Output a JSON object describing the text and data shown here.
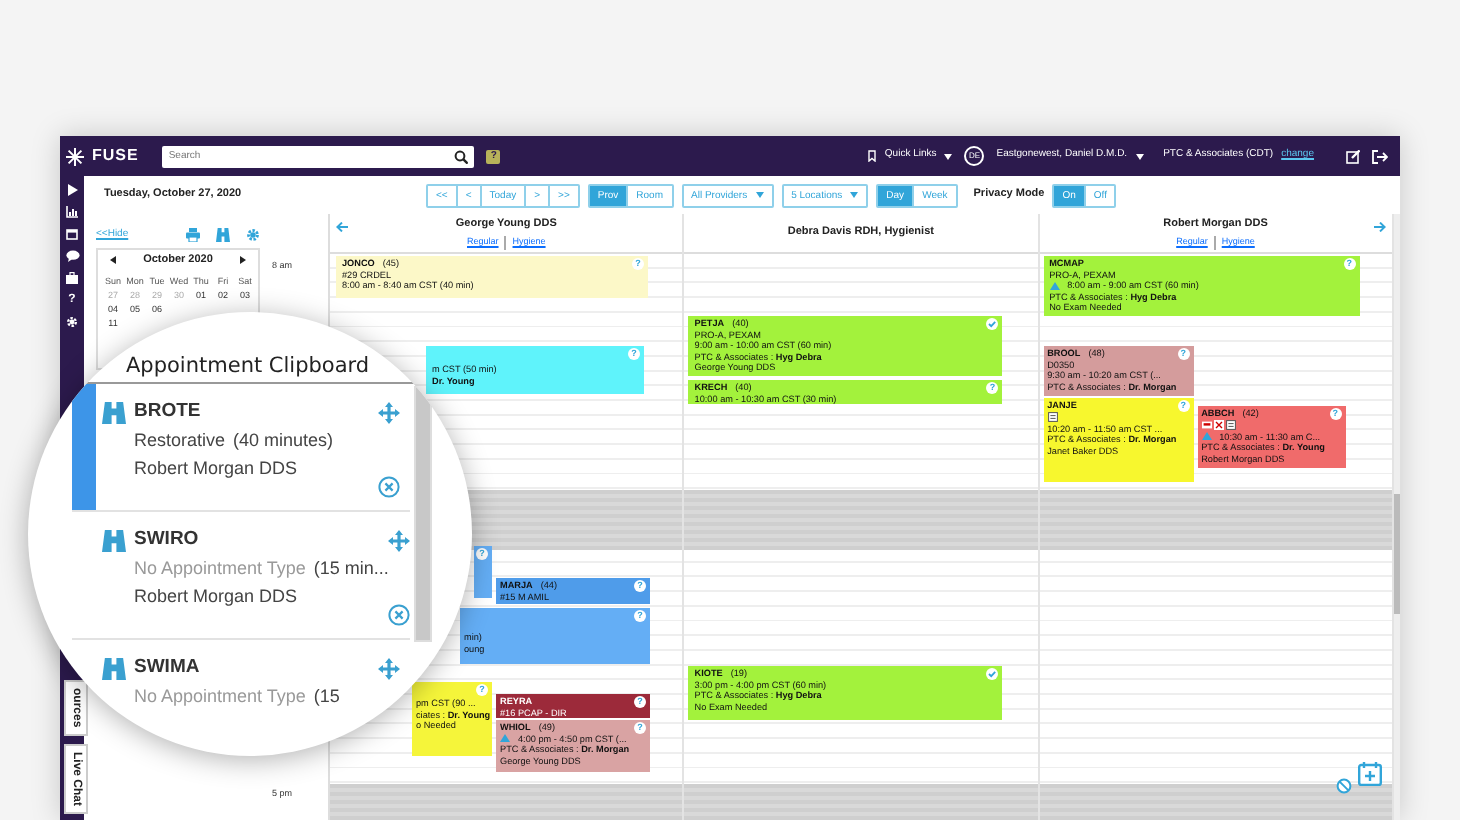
{
  "topbar": {
    "logo": "FUSE",
    "search": {
      "placeholder": "Search"
    },
    "help": "?",
    "quick_links": "Quick Links",
    "avatar_initials": "DE",
    "user_name": "Eastgonewest, Daniel D.M.D.",
    "practice": "PTC & Associates (CDT)",
    "change_link": "change"
  },
  "sidebar": {
    "help": "?",
    "tabs": [
      "ources",
      "Live Chat"
    ]
  },
  "toolbar": {
    "date": "Tuesday, October 27, 2020",
    "nav_buttons": [
      "<<",
      "<",
      "Today",
      ">",
      ">>"
    ],
    "view_toggle": [
      {
        "label": "Prov",
        "selected": true
      },
      {
        "label": "Room",
        "selected": false
      }
    ],
    "dropdowns": [
      "All Providers",
      "5 Locations"
    ],
    "range_toggle": [
      {
        "label": "Day",
        "selected": true
      },
      {
        "label": "Week",
        "selected": false
      }
    ],
    "privacy_label": "Privacy Mode",
    "privacy_toggle": [
      {
        "label": "On",
        "selected": true
      },
      {
        "label": "Off",
        "selected": false
      }
    ]
  },
  "left_panel": {
    "hide_link": "<<Hide",
    "calendar": {
      "month": "October 2020",
      "weekdays": [
        "Sun",
        "Mon",
        "Tue",
        "Wed",
        "Thu",
        "Fri",
        "Sat"
      ],
      "weeks": [
        [
          {
            "day": "27",
            "muted": true
          },
          {
            "day": "28",
            "muted": true
          },
          {
            "day": "29",
            "muted": true
          },
          {
            "day": "30",
            "muted": true
          },
          {
            "day": "01",
            "muted": false
          },
          {
            "day": "02",
            "muted": false
          },
          {
            "day": "03",
            "muted": false
          }
        ],
        [
          {
            "day": "04",
            "muted": false
          },
          {
            "day": "05",
            "muted": false
          },
          {
            "day": "06",
            "muted": false
          }
        ],
        [
          {
            "day": "11",
            "muted": false
          }
        ]
      ]
    }
  },
  "time_labels": [
    "8 am",
    "5 pm"
  ],
  "providers": [
    {
      "name": "George Young DDS",
      "tabs": [
        "Regular",
        "Hygiene"
      ],
      "has_prev": true,
      "has_next": false,
      "appointments": [
        {
          "name": "JONCO",
          "count": "(45)",
          "procedure": "#29 CRDEL",
          "time": "8:00 am - 8:40 am CST (40 min)",
          "time_alert": false,
          "color": "#fcf8c8",
          "help_mark": "?",
          "confirmed": false
        },
        {
          "lines": [
            "m CST (50 min)",
            "**Dr. Young**"
          ],
          "color": "#5ff3fb",
          "help_mark": "?",
          "confirmed": false
        },
        {
          "color": "#64aef5",
          "help_mark": "?",
          "confirmed": false
        },
        {
          "name": "MARJA",
          "count": "(44)",
          "procedure": "#15 M AMIL",
          "color": "#4f9cea",
          "help_mark": "?",
          "confirmed": false
        },
        {
          "lines": [
            "min)",
            "oung"
          ],
          "color": "#64aef5",
          "help_mark": "?",
          "confirmed": false
        },
        {
          "lines": [
            "pm CST (90 ...",
            "ciates : **Dr. Young**",
            "o Needed"
          ],
          "color": "#f5f53a",
          "help_mark": "?",
          "confirmed": false
        },
        {
          "name": "REYRA",
          "procedure": "#16 PCAP - DIR",
          "color": "#9c2a3a",
          "help_mark": "?",
          "confirmed": false
        },
        {
          "name": "WHIOL",
          "count": "(49)",
          "time": "4:00 pm - 4:50 pm CST (...",
          "time_alert": true,
          "lines": [
            "PTC & Associates : **Dr. Morgan**",
            "George Young DDS"
          ],
          "color": "#d9a3a3",
          "help_mark": "?",
          "confirmed": false
        }
      ]
    },
    {
      "name": "Debra Davis RDH, Hygienist",
      "has_prev": false,
      "has_next": false,
      "appointments": [
        {
          "name": "PETJA",
          "count": "(40)",
          "procedure": "PRO-A, PEXAM",
          "time": "9:00 am - 10:00 am CST (60 min)",
          "time_alert": false,
          "lines": [
            "PTC & Associates : **Hyg Debra**",
            "George Young DDS"
          ],
          "color": "#a3f23c",
          "confirmed": true
        },
        {
          "name": "KRECH",
          "count": "(40)",
          "time": "10:00 am - 10:30 am CST (30 min)",
          "time_alert": false,
          "color": "#a3f23c",
          "help_mark": "?",
          "confirmed": false
        },
        {
          "name": "KIOTE",
          "count": "(19)",
          "time": "3:00 pm - 4:00 pm CST (60 min)",
          "time_alert": false,
          "lines": [
            "PTC & Associates : **Hyg Debra**",
            "No Exam Needed"
          ],
          "color": "#a3f23c",
          "confirmed": true
        }
      ]
    },
    {
      "name": "Robert Morgan DDS",
      "tabs": [
        "Regular",
        "Hygiene"
      ],
      "has_prev": false,
      "has_next": true,
      "appointments": [
        {
          "name": "MCMAP",
          "procedure": "PRO-A, PEXAM",
          "time": "8:00 am - 9:00 am CST (60 min)",
          "time_alert": true,
          "lines": [
            "PTC & Associates : **Hyg Debra**",
            "No Exam Needed"
          ],
          "color": "#a3f23c",
          "help_mark": "?",
          "confirmed": false
        },
        {
          "name": "BROOL",
          "count": "(48)",
          "procedure": "D0350",
          "time": "9:30 am - 10:20 am CST (...",
          "time_alert": false,
          "lines": [
            "PTC & Associates : **Dr. Morgan**"
          ],
          "color": "#d49c9c",
          "help_mark": "?",
          "confirmed": false
        },
        {
          "name": "JANJE",
          "flags": [
            {
              "kind": "note"
            }
          ],
          "time": "10:20 am - 11:50 am CST ...",
          "time_alert": false,
          "lines": [
            "PTC & Associates : **Dr. Morgan**",
            "Janet Baker DDS"
          ],
          "color": "#f7f72e",
          "help_mark": "?",
          "confirmed": false
        },
        {
          "name": "ABBCH",
          "count": "(42)",
          "flags": [
            {
              "kind": "card"
            },
            {
              "kind": "cross"
            },
            {
              "kind": "note"
            }
          ],
          "time": "10:30 am - 11:30 am C...",
          "time_alert": true,
          "lines": [
            "PTC & Associates : **Dr. Young**",
            "Robert Morgan DDS"
          ],
          "color": "#f06b6b",
          "help_mark": "?",
          "confirmed": false
        }
      ]
    }
  ],
  "clipboard": {
    "title": "Appointment Clipboard",
    "items": [
      {
        "name": "BROTE",
        "type": "Restorative",
        "duration": "(40 minutes)",
        "type_missing": false,
        "provider": "Robert Morgan DDS",
        "selected": true
      },
      {
        "name": "SWIRO",
        "type": "No Appointment Type",
        "duration": "(15 min...",
        "type_missing": true,
        "provider": "Robert Morgan DDS",
        "selected": false
      },
      {
        "name": "SWIMA",
        "type": "No Appointment Type",
        "duration": "(15",
        "type_missing": true,
        "selected": false
      }
    ]
  }
}
